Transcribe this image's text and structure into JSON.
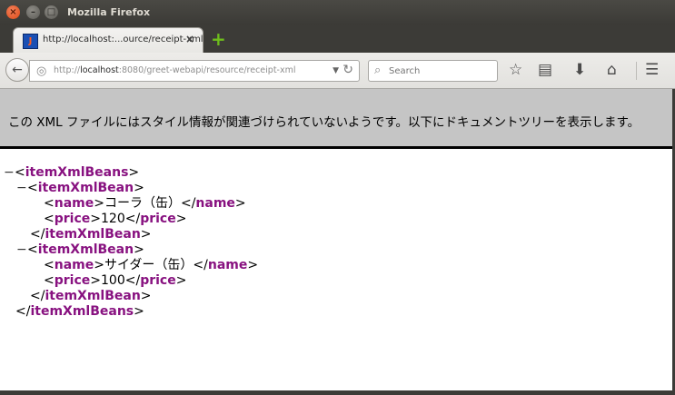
{
  "window": {
    "title": "Mozilla Firefox"
  },
  "tab": {
    "title": "http://localhost:...ource/receipt-xml",
    "close": "×"
  },
  "newtab": "+",
  "nav": {
    "url_prefix": "http://",
    "url_host": "localhost",
    "url_rest": ":8080/greet-webapi/resource/receipt-xml",
    "search_placeholder": "Search"
  },
  "infobar": {
    "message": "この XML ファイルにはスタイル情報が関連づけられていないようです。以下にドキュメントツリーを表示します。"
  },
  "xml": {
    "root_tag": "itemXmlBeans",
    "item_tag": "itemXmlBean",
    "name_tag": "name",
    "price_tag": "price",
    "items": [
      {
        "name": "コーラ（缶）",
        "price": "120"
      },
      {
        "name": "サイダー（缶）",
        "price": "100"
      }
    ],
    "collapse_symbol": "−"
  }
}
